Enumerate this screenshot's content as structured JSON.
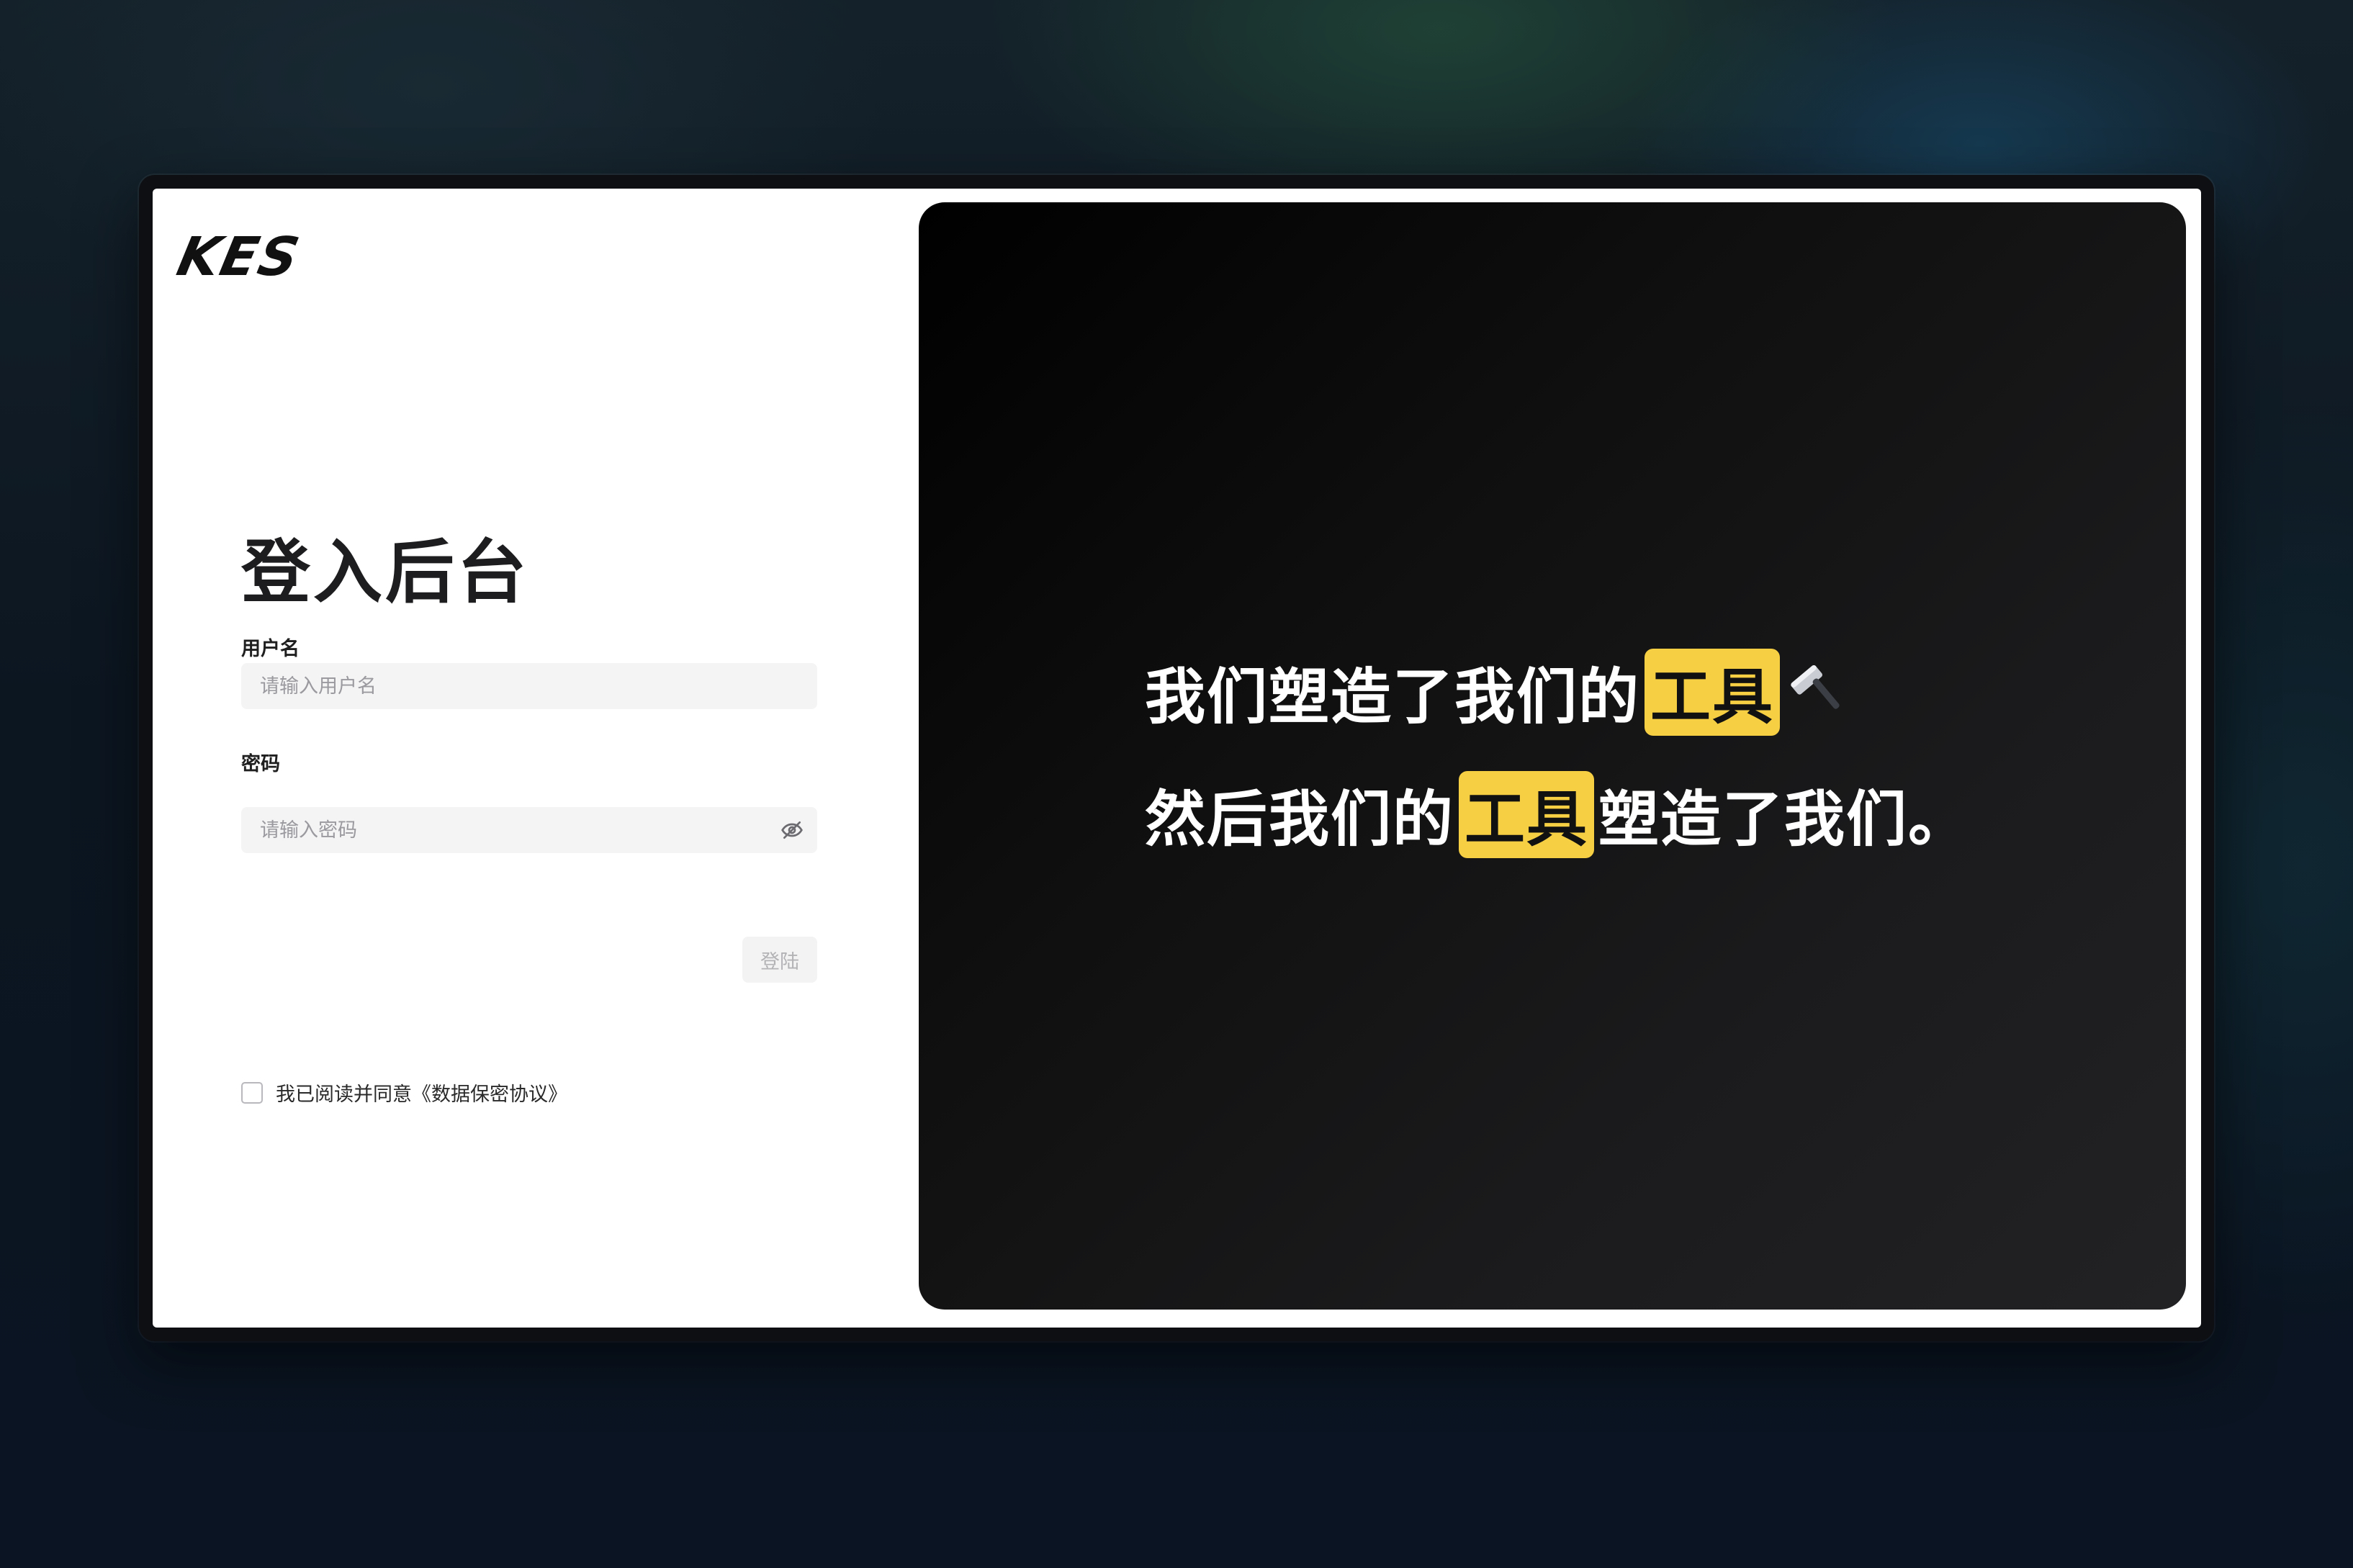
{
  "brand": {
    "logo_text": "KES"
  },
  "login": {
    "title": "登入后台",
    "username": {
      "label": "用户名",
      "placeholder": "请输入用户名",
      "value": ""
    },
    "password": {
      "label": "密码",
      "placeholder": "请输入密码",
      "value": ""
    },
    "agreement": {
      "text": "我已阅读并同意《数据保密协议》",
      "checked": false
    },
    "submit_label": "登陆"
  },
  "hero": {
    "line1": {
      "prefix": "我们塑造了我们的",
      "highlight": "工具",
      "icon": "hammer-icon"
    },
    "line2": {
      "prefix": "然后我们的",
      "highlight": "工具",
      "suffix": "塑造了我们。"
    },
    "highlight_color": "#f7cf43"
  }
}
